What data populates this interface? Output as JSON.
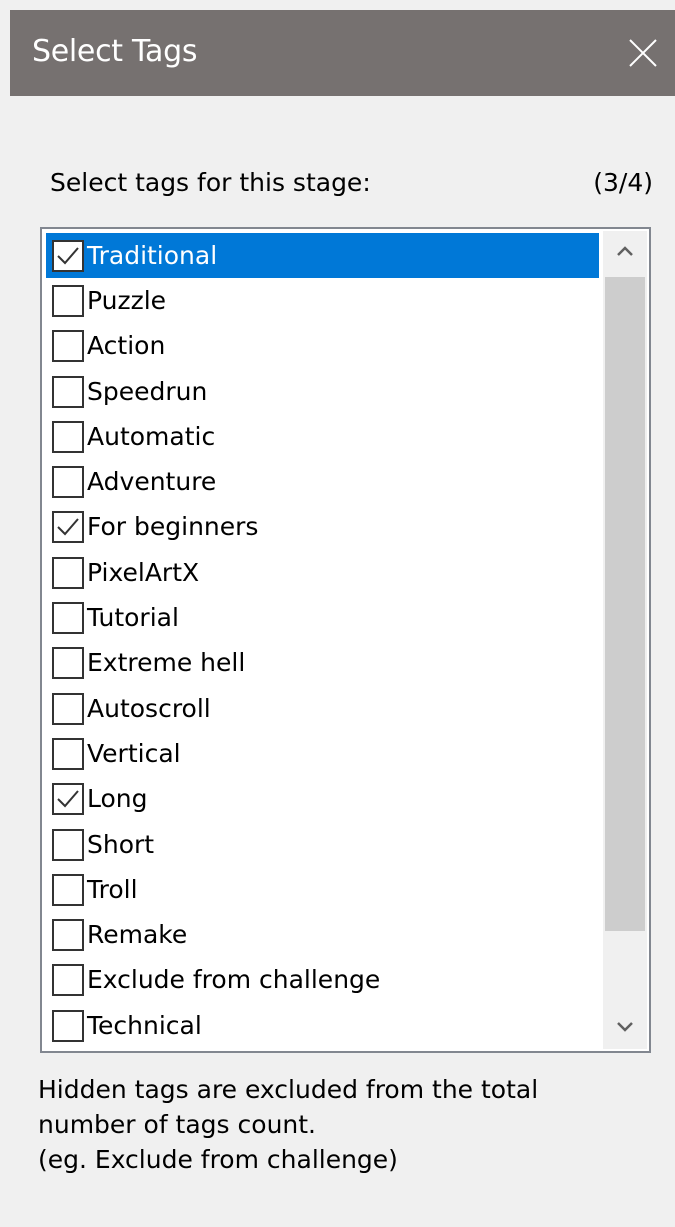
{
  "window": {
    "title": "Select Tags",
    "close_icon": "close-icon"
  },
  "prompt": {
    "label": "Select tags for this stage:",
    "count": "(3/4)"
  },
  "tags": [
    {
      "label": "Traditional",
      "checked": true,
      "selected": true
    },
    {
      "label": "Puzzle",
      "checked": false,
      "selected": false
    },
    {
      "label": "Action",
      "checked": false,
      "selected": false
    },
    {
      "label": "Speedrun",
      "checked": false,
      "selected": false
    },
    {
      "label": "Automatic",
      "checked": false,
      "selected": false
    },
    {
      "label": "Adventure",
      "checked": false,
      "selected": false
    },
    {
      "label": "For beginners",
      "checked": true,
      "selected": false
    },
    {
      "label": "PixelArtX",
      "checked": false,
      "selected": false
    },
    {
      "label": "Tutorial",
      "checked": false,
      "selected": false
    },
    {
      "label": "Extreme hell",
      "checked": false,
      "selected": false
    },
    {
      "label": "Autoscroll",
      "checked": false,
      "selected": false
    },
    {
      "label": "Vertical",
      "checked": false,
      "selected": false
    },
    {
      "label": "Long",
      "checked": true,
      "selected": false
    },
    {
      "label": "Short",
      "checked": false,
      "selected": false
    },
    {
      "label": "Troll",
      "checked": false,
      "selected": false
    },
    {
      "label": "Remake",
      "checked": false,
      "selected": false
    },
    {
      "label": "Exclude from challenge",
      "checked": false,
      "selected": false
    },
    {
      "label": "Technical",
      "checked": false,
      "selected": false
    }
  ],
  "footnote": {
    "line1": "Hidden tags are excluded from the total",
    "line2": "number of tags count.",
    "line3": "(eg. Exclude from challenge)"
  },
  "colors": {
    "titlebar": "#767170",
    "selection": "#0078d7",
    "background": "#f0f0f0"
  }
}
